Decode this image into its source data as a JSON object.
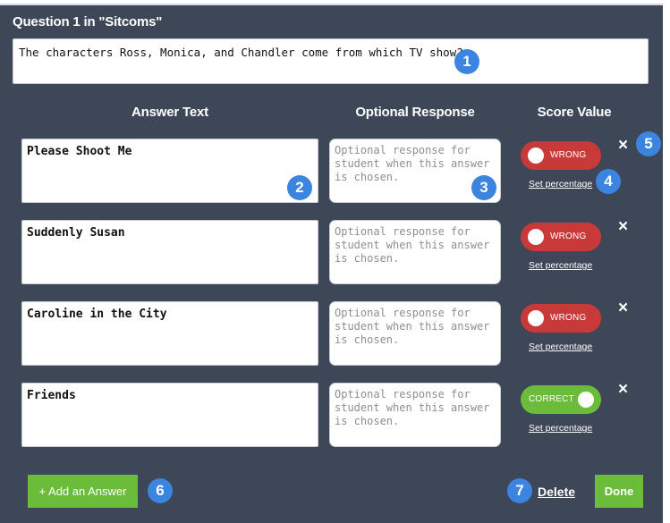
{
  "question": {
    "title": "Question 1 in \"Sitcoms\"",
    "text": "The characters Ross, Monica, and Chandler come from which TV show?"
  },
  "columns": {
    "answer_text": "Answer Text",
    "optional_response": "Optional Response",
    "score_value": "Score Value"
  },
  "answers": [
    {
      "text": "Please Shoot Me",
      "response_placeholder": "Optional response for student when this answer is chosen.",
      "score": "WRONG",
      "set_percentage": "Set percentage"
    },
    {
      "text": "Suddenly Susan",
      "response_placeholder": "Optional response for student when this answer is chosen.",
      "score": "WRONG",
      "set_percentage": "Set percentage"
    },
    {
      "text": "Caroline in the City",
      "response_placeholder": "Optional response for student when this answer is chosen.",
      "score": "WRONG",
      "set_percentage": "Set percentage"
    },
    {
      "text": "Friends",
      "response_placeholder": "Optional response for student when this answer is chosen.",
      "score": "CORRECT",
      "set_percentage": "Set percentage"
    }
  ],
  "remove_icon": "×",
  "badges": [
    "1",
    "2",
    "3",
    "4",
    "5",
    "6",
    "7"
  ],
  "footer": {
    "add_answer": "+ Add an Answer",
    "delete": "Delete",
    "done": "Done"
  },
  "colors": {
    "panel": "#3e4757",
    "wrong": "#c83a3a",
    "correct": "#6cbc3c",
    "badge": "#3b84e0"
  },
  "icons": {
    "remove": "close-icon"
  }
}
